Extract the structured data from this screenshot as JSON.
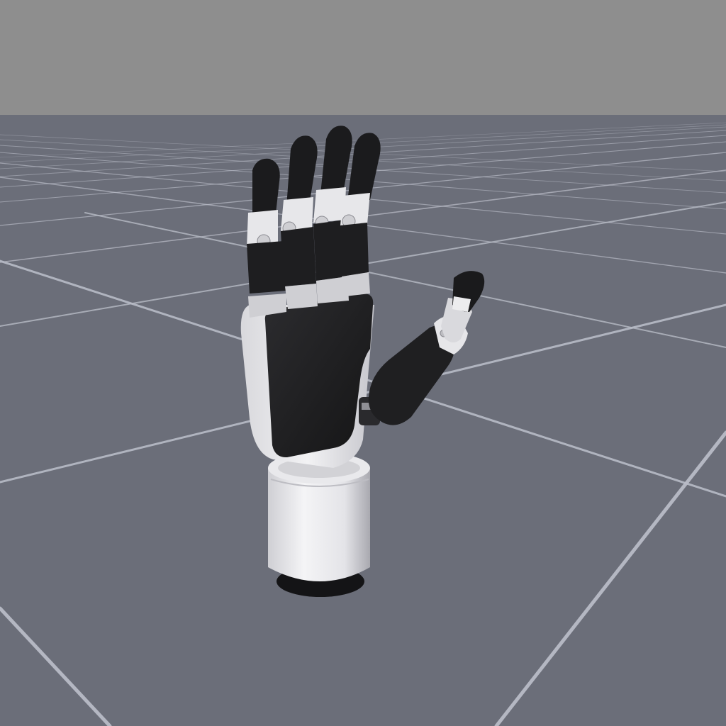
{
  "scene": {
    "sky_color": "#8e8e8e",
    "floor_color": "#6b6e79",
    "grid_line_color": "#b8bbc6",
    "hand": {
      "shell_color": "#e9e9ec",
      "cover_color": "#222224",
      "joint_color": "#bdbdc2"
    }
  }
}
